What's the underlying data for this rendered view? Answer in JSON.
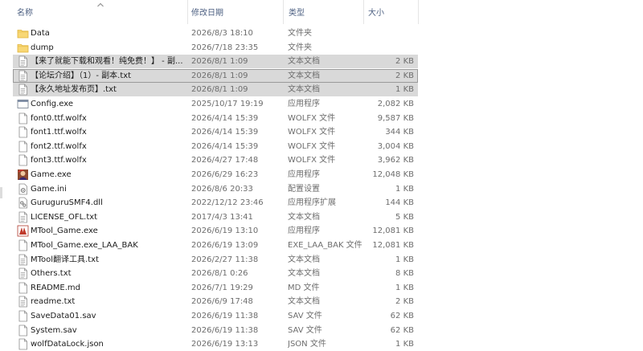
{
  "columns": {
    "name": "名称",
    "date": "修改日期",
    "type": "类型",
    "size": "大小"
  },
  "files": [
    {
      "name": "Data",
      "date": "2026/8/3 18:10",
      "type": "文件夹",
      "size": "",
      "icon": "folder-icon",
      "selected": false
    },
    {
      "name": "dump",
      "date": "2026/7/18 23:35",
      "type": "文件夹",
      "size": "",
      "icon": "folder-icon",
      "selected": false
    },
    {
      "name": "【来了就能下载和观看！纯免费！】 - 副...",
      "date": "2026/8/1 1:09",
      "type": "文本文档",
      "size": "2 KB",
      "icon": "text-file-icon",
      "selected": true
    },
    {
      "name": "【论坛介绍】（1）- 副本.txt",
      "date": "2026/8/1 1:09",
      "type": "文本文档",
      "size": "2 KB",
      "icon": "text-file-icon",
      "selected": true,
      "focused": true
    },
    {
      "name": "【永久地址发布页】.txt",
      "date": "2026/8/1 1:09",
      "type": "文本文档",
      "size": "1 KB",
      "icon": "text-file-icon",
      "selected": true
    },
    {
      "name": "Config.exe",
      "date": "2025/10/17 19:19",
      "type": "应用程序",
      "size": "2,082 KB",
      "icon": "window-app-icon",
      "selected": false
    },
    {
      "name": "font0.ttf.wolfx",
      "date": "2026/4/14 15:39",
      "type": "WOLFX 文件",
      "size": "9,587 KB",
      "icon": "blank-file-icon",
      "selected": false
    },
    {
      "name": "font1.ttf.wolfx",
      "date": "2026/4/14 15:39",
      "type": "WOLFX 文件",
      "size": "344 KB",
      "icon": "blank-file-icon",
      "selected": false
    },
    {
      "name": "font2.ttf.wolfx",
      "date": "2026/4/14 15:39",
      "type": "WOLFX 文件",
      "size": "3,004 KB",
      "icon": "blank-file-icon",
      "selected": false
    },
    {
      "name": "font3.ttf.wolfx",
      "date": "2026/4/27 17:48",
      "type": "WOLFX 文件",
      "size": "3,962 KB",
      "icon": "blank-file-icon",
      "selected": false
    },
    {
      "name": "Game.exe",
      "date": "2026/6/29 16:23",
      "type": "应用程序",
      "size": "12,048 KB",
      "icon": "game-exe-icon",
      "selected": false
    },
    {
      "name": "Game.ini",
      "date": "2026/8/6 20:33",
      "type": "配置设置",
      "size": "1 KB",
      "icon": "settings-file-icon",
      "selected": false
    },
    {
      "name": "GuruguruSMF4.dll",
      "date": "2022/12/12 23:46",
      "type": "应用程序扩展",
      "size": "144 KB",
      "icon": "dll-file-icon",
      "selected": false
    },
    {
      "name": "LICENSE_OFL.txt",
      "date": "2017/4/3 13:41",
      "type": "文本文档",
      "size": "5 KB",
      "icon": "text-file-icon",
      "selected": false
    },
    {
      "name": "MTool_Game.exe",
      "date": "2026/6/19 13:10",
      "type": "应用程序",
      "size": "12,081 KB",
      "icon": "mtool-exe-icon",
      "selected": false
    },
    {
      "name": "MTool_Game.exe_LAA_BAK",
      "date": "2026/6/19 13:09",
      "type": "EXE_LAA_BAK 文件",
      "size": "12,081 KB",
      "icon": "blank-file-icon",
      "selected": false
    },
    {
      "name": "MTool翻译工具.txt",
      "date": "2026/2/27 11:38",
      "type": "文本文档",
      "size": "1 KB",
      "icon": "text-file-icon",
      "selected": false
    },
    {
      "name": "Others.txt",
      "date": "2026/8/1 0:26",
      "type": "文本文档",
      "size": "8 KB",
      "icon": "text-file-icon",
      "selected": false
    },
    {
      "name": "README.md",
      "date": "2026/7/1 19:29",
      "type": "MD 文件",
      "size": "1 KB",
      "icon": "blank-file-icon",
      "selected": false
    },
    {
      "name": "readme.txt",
      "date": "2026/6/9 17:48",
      "type": "文本文档",
      "size": "2 KB",
      "icon": "text-file-icon",
      "selected": false
    },
    {
      "name": "SaveData01.sav",
      "date": "2026/6/19 11:38",
      "type": "SAV 文件",
      "size": "62 KB",
      "icon": "blank-file-icon",
      "selected": false
    },
    {
      "name": "System.sav",
      "date": "2026/6/19 11:38",
      "type": "SAV 文件",
      "size": "62 KB",
      "icon": "blank-file-icon",
      "selected": false
    },
    {
      "name": "wolfDataLock.json",
      "date": "2026/6/19 13:13",
      "type": "JSON 文件",
      "size": "1 KB",
      "icon": "blank-file-icon",
      "selected": false
    }
  ],
  "colors": {
    "header_text": "#4d6082",
    "selection": "#d9d9d9",
    "folder": "#f8d775",
    "folder_dark": "#e0b23a"
  }
}
